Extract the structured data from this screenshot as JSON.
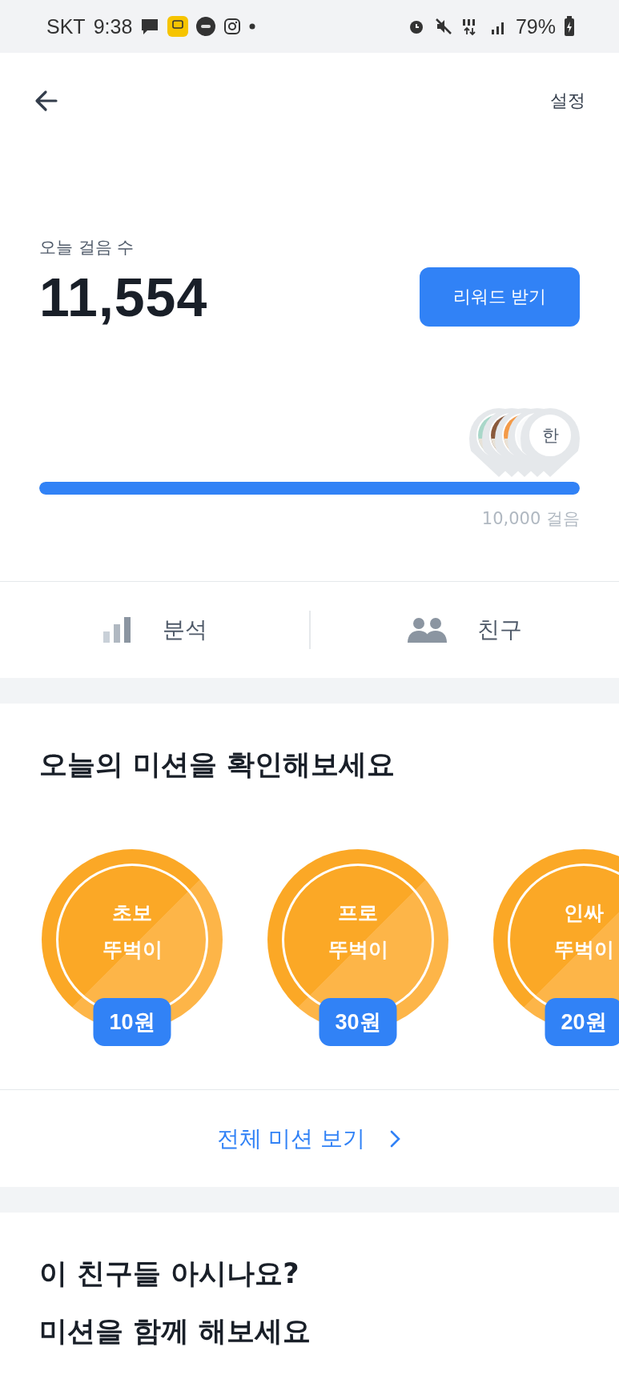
{
  "status_bar": {
    "carrier": "SKT",
    "time": "9:38",
    "battery": "79%"
  },
  "header": {
    "settings": "설정"
  },
  "steps": {
    "label": "오늘 걸음 수",
    "count": "11,554",
    "reward_button": "리워드 받기",
    "level": 1,
    "goal": "10,000 걸음",
    "friends": [
      {
        "kind": "picture"
      },
      {
        "kind": "picture"
      },
      {
        "kind": "picture"
      },
      {
        "kind": "blank"
      },
      {
        "kind": "initial",
        "initial": "한"
      }
    ]
  },
  "tabs": [
    {
      "label": "분석",
      "kind": "analysis"
    },
    {
      "label": "친구",
      "kind": "friends"
    }
  ],
  "missions": {
    "title": "오늘의 미션을 확인해보세요",
    "items": [
      {
        "line1": "초보",
        "line2": "뚜벅이",
        "reward": "10원"
      },
      {
        "line1": "프로",
        "line2": "뚜벅이",
        "reward": "30원"
      },
      {
        "line1": "인싸",
        "line2": "뚜벅이",
        "reward": "20원"
      }
    ],
    "more": "전체 미션 보기"
  },
  "friends_section": {
    "title_line1": "이 친구들 아시나요?",
    "title_line2": "미션을 함께 해보세요"
  }
}
